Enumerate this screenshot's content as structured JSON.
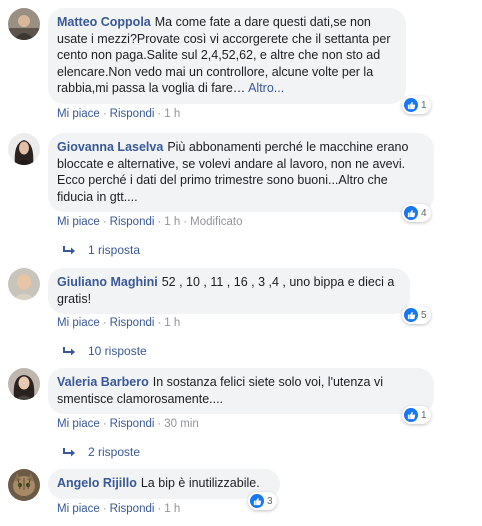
{
  "comments": [
    {
      "author": "Matteo Coppola",
      "text": "Ma come fate a dare questi dati,se non usate i mezzi?Provate così vi accorgerete che il settanta per cento non paga.Salite sul 2,4,52,62, e altre che non sto ad elencare.Non vedo mai un controllore, alcune volte per la rabbia,mi passa la voglia di fare…",
      "more": "Altro...",
      "like": "Mi piace",
      "reply": "Rispondi",
      "time": "1 h",
      "reactions": "1"
    },
    {
      "author": "Giovanna Laselva",
      "text": "Più abbonamenti perché le macchine erano bloccate e alternative, se volevi andare al lavoro, non ne avevi. Ecco perché i dati del primo trimestre sono buoni...Altro che fiducia in gtt....",
      "like": "Mi piace",
      "reply": "Rispondi",
      "time": "1 h",
      "edited": "Modificato",
      "reactions": "4",
      "replies": "1 risposta"
    },
    {
      "author": "Giuliano Maghini",
      "text": "52 , 10 , 11 , 16 , 3 ,4 , uno bippa e dieci a gratis!",
      "like": "Mi piace",
      "reply": "Rispondi",
      "time": "1 h",
      "reactions": "5",
      "replies": "10 risposte"
    },
    {
      "author": "Valeria Barbero",
      "text": "In sostanza felici siete solo voi, l'utenza vi smentisce clamorosamente....",
      "like": "Mi piace",
      "reply": "Rispondi",
      "time": "30 min",
      "reactions": "1",
      "replies": "2 risposte"
    },
    {
      "author": "Angelo Rijillo",
      "text": "La bip è inutilizzabile.",
      "like": "Mi piace",
      "reply": "Rispondi",
      "time": "1 h",
      "reactions": "3"
    }
  ],
  "icons": {
    "reaction": "like-thumb-icon",
    "replies": "reply-arrow-icon"
  },
  "colors": {
    "link": "#385898",
    "bubble": "#f2f3f5",
    "like_blue": "#1877f2",
    "meta": "#90949c"
  }
}
